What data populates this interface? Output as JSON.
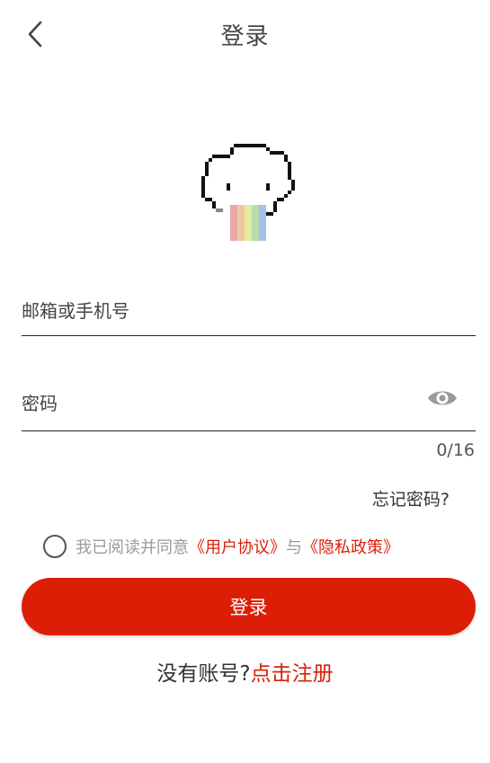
{
  "header": {
    "title": "登录",
    "back_icon": "chevron-left-icon"
  },
  "logo": {
    "icon": "pixel-cloud-rainbow-logo",
    "colors": [
      "#e8a8a8",
      "#efc8a0",
      "#e8e8a0",
      "#b8dcb0",
      "#a8c0e8"
    ]
  },
  "form": {
    "account_placeholder": "邮箱或手机号",
    "password_placeholder": "密码",
    "password_toggle_icon": "eye-icon",
    "password_counter": "0/16",
    "forgot_password": "忘记密码?"
  },
  "agreement": {
    "prefix": "我已阅读并同意",
    "user_agreement": "《用户协议》",
    "conjunction": "与",
    "privacy_policy": "《隐私政策》"
  },
  "login_button": "登录",
  "register": {
    "prompt": "没有账号?",
    "link": "点击注册"
  },
  "colors": {
    "accent": "#dc1e07",
    "link": "#d9200a",
    "muted_text": "#9a9a9a"
  }
}
